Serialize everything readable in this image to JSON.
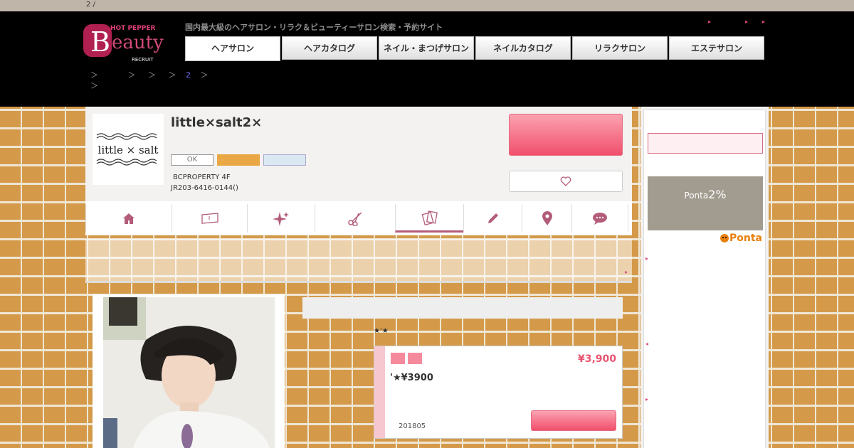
{
  "top_strip": {
    "text": "2 /"
  },
  "header": {
    "logo_text": "Beauty",
    "logo_sub": "HOT PEPPER",
    "logo_brand": "RECRUIT",
    "tagline": "国内最大級のヘアサロン・リラク＆ビューティーサロン検索・予約サイト",
    "link_glyphs": [
      "▸",
      "▸",
      "▸"
    ],
    "tabs": [
      "ヘアサロン",
      "ヘアカタログ",
      "ネイル・まつげサロン",
      "ネイルカタログ",
      "リラクサロン",
      "エステサロン"
    ],
    "active_tab": 0
  },
  "breadcrumb": {
    "line1": [
      "＞",
      "＞",
      "＞",
      "＞",
      "2",
      "＞"
    ],
    "line2": [
      "＞"
    ]
  },
  "salon": {
    "logo_text": "little × salt",
    "name": "little×salt2×",
    "badges": [
      "OK",
      "",
      ""
    ],
    "address": "BCPROPERTY 4F",
    "phone": "JR203-6416-0144()"
  },
  "nav": {
    "icons": [
      "home-icon",
      "book-icon",
      "sparkle-icon",
      "scissors-icon",
      "cards-icon",
      "pencil-icon",
      "map-pin-icon",
      "chat-icon"
    ],
    "active_index": 4
  },
  "coupon": {
    "stars": "★'★",
    "price": "¥3,900",
    "title": "'★¥3900",
    "date": "201805"
  },
  "sidebar": {
    "title": "",
    "button_label": "",
    "subtitle": "",
    "ponta_label": "Ponta",
    "ponta_percent": "2%",
    "ponta_logo": "Ponta",
    "arrow_glyphs": [
      "▸",
      "◂",
      "▸"
    ]
  },
  "colors": {
    "accent_pink": "#f14f6c",
    "header_bg": "#000000",
    "nav_active": "#b35c7a",
    "ponta_orange": "#e8800c"
  }
}
